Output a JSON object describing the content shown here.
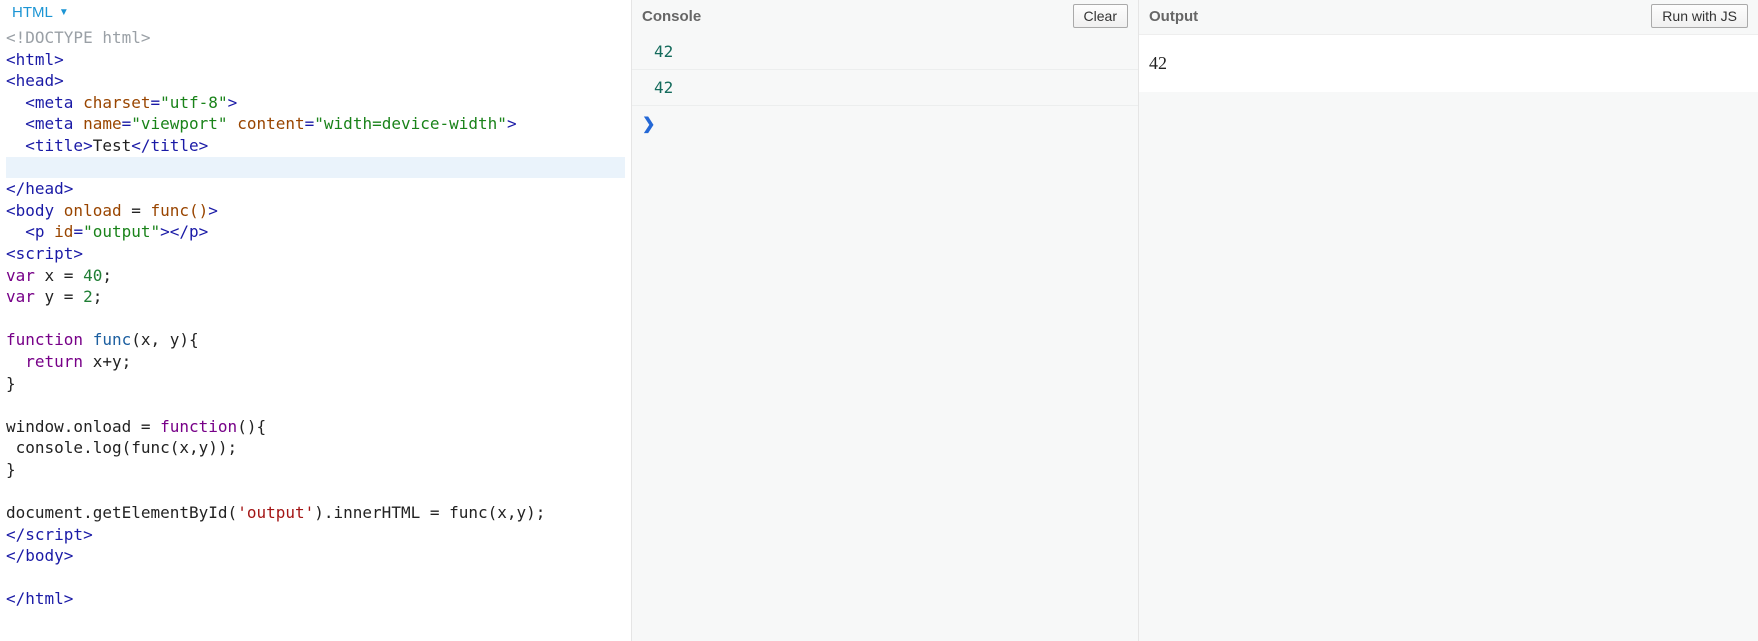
{
  "editor": {
    "tab_label": "HTML",
    "code_tokens": [
      [
        {
          "c": "t-doctype",
          "t": "<!DOCTYPE html>"
        }
      ],
      [
        {
          "c": "t-tag",
          "t": "<html>"
        }
      ],
      [
        {
          "c": "t-tag",
          "t": "<head>"
        }
      ],
      [
        {
          "c": "t-plain",
          "t": "  "
        },
        {
          "c": "t-tag",
          "t": "<meta "
        },
        {
          "c": "t-attr",
          "t": "charset"
        },
        {
          "c": "t-tag",
          "t": "="
        },
        {
          "c": "t-str",
          "t": "\"utf-8\""
        },
        {
          "c": "t-tag",
          "t": ">"
        }
      ],
      [
        {
          "c": "t-plain",
          "t": "  "
        },
        {
          "c": "t-tag",
          "t": "<meta "
        },
        {
          "c": "t-attr",
          "t": "name"
        },
        {
          "c": "t-tag",
          "t": "="
        },
        {
          "c": "t-str",
          "t": "\"viewport\""
        },
        {
          "c": "t-tag",
          "t": " "
        },
        {
          "c": "t-attr",
          "t": "content"
        },
        {
          "c": "t-tag",
          "t": "="
        },
        {
          "c": "t-str",
          "t": "\"width=device-width\""
        },
        {
          "c": "t-tag",
          "t": ">"
        }
      ],
      [
        {
          "c": "t-plain",
          "t": "  "
        },
        {
          "c": "t-tag",
          "t": "<title>"
        },
        {
          "c": "t-text",
          "t": "Test"
        },
        {
          "c": "t-tag",
          "t": "</title>"
        }
      ],
      [
        {
          "c": "t-plain",
          "t": " ",
          "hl": true
        }
      ],
      [
        {
          "c": "t-tag",
          "t": "</head>"
        }
      ],
      [
        {
          "c": "t-tag",
          "t": "<body "
        },
        {
          "c": "t-attr",
          "t": "onload"
        },
        {
          "c": "t-plain",
          "t": " = "
        },
        {
          "c": "t-attr",
          "t": "func()"
        },
        {
          "c": "t-tag",
          "t": ">"
        }
      ],
      [
        {
          "c": "t-plain",
          "t": "  "
        },
        {
          "c": "t-tag",
          "t": "<p "
        },
        {
          "c": "t-attr",
          "t": "id"
        },
        {
          "c": "t-tag",
          "t": "="
        },
        {
          "c": "t-str",
          "t": "\"output\""
        },
        {
          "c": "t-tag",
          "t": "></p>"
        }
      ],
      [
        {
          "c": "t-tag",
          "t": "<script>"
        }
      ],
      [
        {
          "c": "t-kw",
          "t": "var"
        },
        {
          "c": "t-plain",
          "t": " x = "
        },
        {
          "c": "t-num",
          "t": "40"
        },
        {
          "c": "t-plain",
          "t": ";"
        }
      ],
      [
        {
          "c": "t-kw",
          "t": "var"
        },
        {
          "c": "t-plain",
          "t": " y = "
        },
        {
          "c": "t-num",
          "t": "2"
        },
        {
          "c": "t-plain",
          "t": ";"
        }
      ],
      [
        {
          "c": "t-plain",
          "t": ""
        }
      ],
      [
        {
          "c": "t-kw",
          "t": "function"
        },
        {
          "c": "t-plain",
          "t": " "
        },
        {
          "c": "t-fn",
          "t": "func"
        },
        {
          "c": "t-plain",
          "t": "(x, y){"
        }
      ],
      [
        {
          "c": "t-plain",
          "t": "  "
        },
        {
          "c": "t-kw",
          "t": "return"
        },
        {
          "c": "t-plain",
          "t": " x+y;"
        }
      ],
      [
        {
          "c": "t-plain",
          "t": "}"
        }
      ],
      [
        {
          "c": "t-plain",
          "t": ""
        }
      ],
      [
        {
          "c": "t-plain",
          "t": "window.onload = "
        },
        {
          "c": "t-kw",
          "t": "function"
        },
        {
          "c": "t-plain",
          "t": "(){"
        }
      ],
      [
        {
          "c": "t-plain",
          "t": " console.log(func(x,y));"
        }
      ],
      [
        {
          "c": "t-plain",
          "t": "}"
        }
      ],
      [
        {
          "c": "t-plain",
          "t": ""
        }
      ],
      [
        {
          "c": "t-plain",
          "t": "document.getElementById("
        },
        {
          "c": "t-strred",
          "t": "'output'"
        },
        {
          "c": "t-plain",
          "t": ").innerHTML = func(x,y);"
        }
      ],
      [
        {
          "c": "t-tag",
          "t": "</script>"
        }
      ],
      [
        {
          "c": "t-tag",
          "t": "</body>"
        }
      ],
      [
        {
          "c": "t-plain",
          "t": ""
        }
      ],
      [
        {
          "c": "t-tag",
          "t": "</html>"
        }
      ]
    ]
  },
  "console": {
    "title": "Console",
    "clear_label": "Clear",
    "entries": [
      "42",
      "42"
    ],
    "prompt": "❯"
  },
  "output": {
    "title": "Output",
    "run_label": "Run with JS",
    "content": "42"
  }
}
